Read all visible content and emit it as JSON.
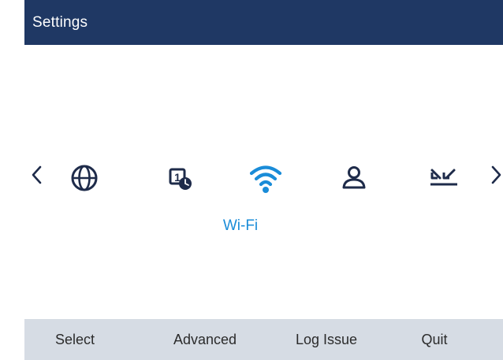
{
  "header": {
    "title": "Settings"
  },
  "carousel": {
    "items": [
      {
        "icon": "globe-icon",
        "label": ""
      },
      {
        "icon": "call-timer-icon",
        "label": ""
      },
      {
        "icon": "wifi-icon",
        "label": "Wi-Fi",
        "selected": true
      },
      {
        "icon": "user-icon",
        "label": ""
      },
      {
        "icon": "call-diversion-icon",
        "label": ""
      }
    ],
    "selected_label": "Wi-Fi"
  },
  "softkeys": {
    "select": "Select",
    "advanced": "Advanced",
    "log_issue": "Log Issue",
    "quit": "Quit"
  },
  "colors": {
    "header_bg": "#1f3864",
    "accent": "#1a8cd8",
    "softkey_bar": "#d6dce4",
    "icon": "#1e2b4a"
  }
}
